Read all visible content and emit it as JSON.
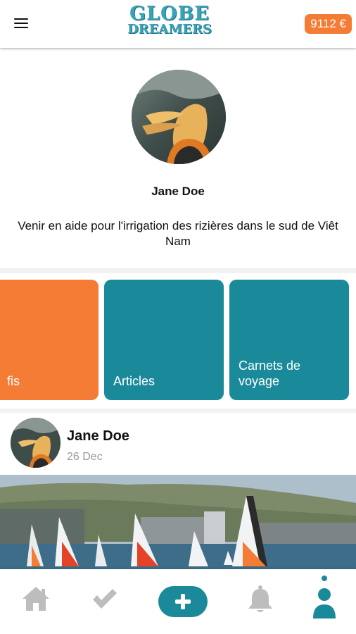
{
  "header": {
    "logo_line1": "GLOBE",
    "logo_line2": "DREAMERS",
    "balance": "9112 €"
  },
  "profile": {
    "name": "Jane Doe",
    "description": "Venir en aide pour l'irrigation des rizières dans le sud de Viêt Nam"
  },
  "cards": [
    {
      "label": "fis",
      "color": "#f47c34"
    },
    {
      "label": "Articles",
      "color": "#1a8a9a"
    },
    {
      "label": "Carnets de voyage",
      "color": "#1a8a9a"
    }
  ],
  "post": {
    "author": "Jane Doe",
    "date": "26 Dec"
  },
  "nav": {
    "items": [
      "home-icon",
      "check-icon",
      "add-icon",
      "bell-icon",
      "profile-icon"
    ],
    "active": "profile-icon"
  },
  "colors": {
    "accent_orange": "#f47c34",
    "accent_teal": "#1a8a9a"
  }
}
